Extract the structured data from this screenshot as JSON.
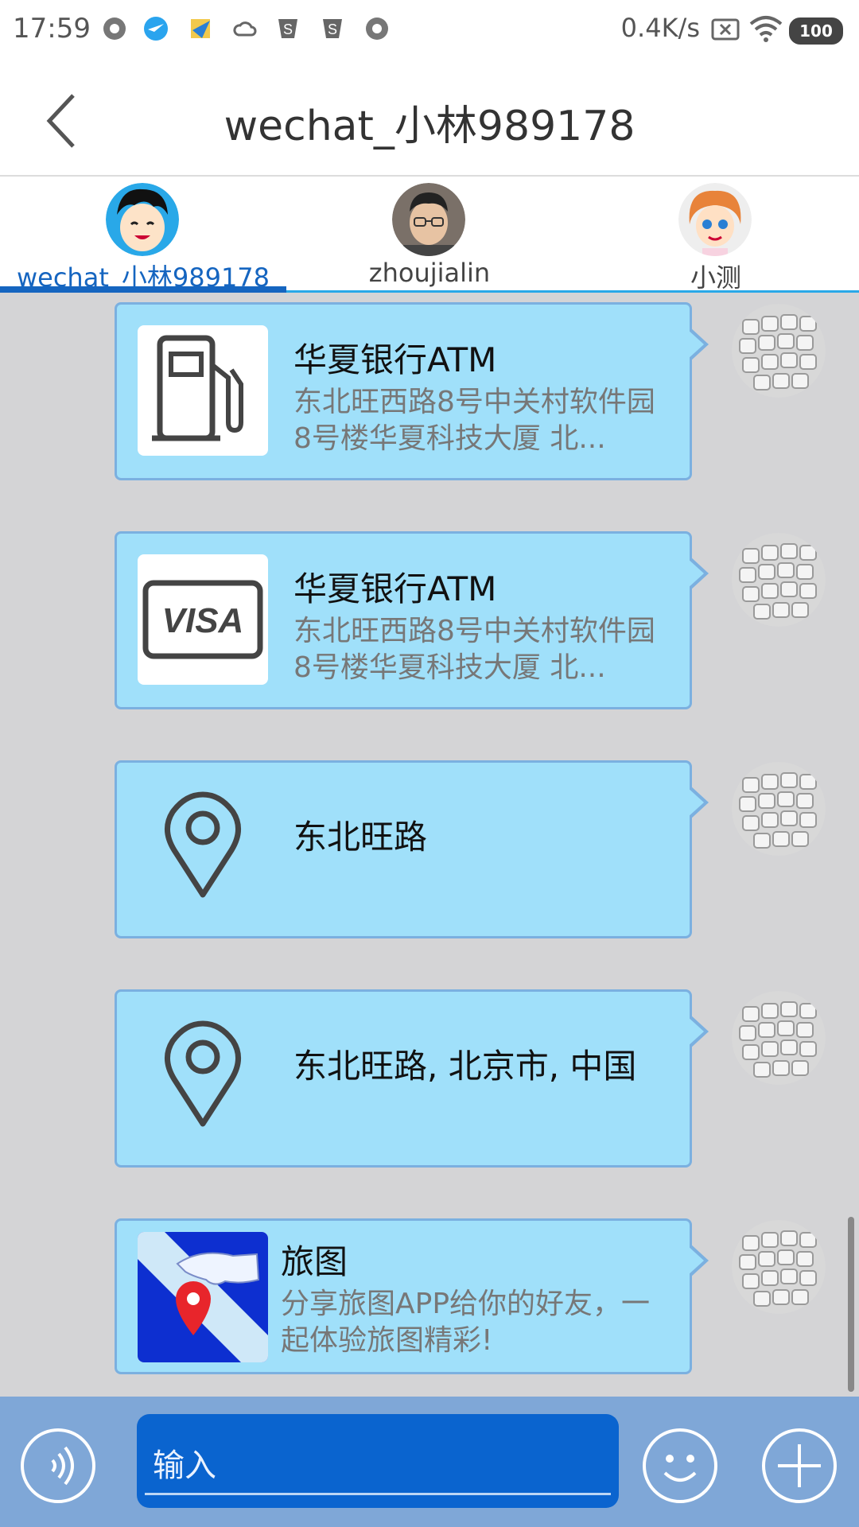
{
  "status_bar": {
    "time": "17:59",
    "network_speed": "0.4K/s",
    "battery": "100"
  },
  "header": {
    "title": "wechat_小林989178"
  },
  "tabs": [
    {
      "label": "wechat_小林989178",
      "active": true
    },
    {
      "label": "zhoujialin",
      "active": false
    },
    {
      "label": "小测",
      "active": false
    }
  ],
  "messages": [
    {
      "type": "poi",
      "icon": "gas-pump-icon",
      "title": "华夏银行ATM",
      "desc": "东北旺西路8号中关村软件园8号楼华夏科技大厦 北..."
    },
    {
      "type": "poi",
      "icon": "visa-card-icon",
      "title": "华夏银行ATM",
      "desc": "东北旺西路8号中关村软件园8号楼华夏科技大厦 北..."
    },
    {
      "type": "location",
      "icon": "location-pin-icon",
      "text": "东北旺路"
    },
    {
      "type": "location",
      "icon": "location-pin-icon",
      "text": "东北旺路, 北京市, 中国"
    },
    {
      "type": "share",
      "icon": "app-logo",
      "title": "旅图",
      "desc": "分享旅图APP给你的好友，一起体验旅图精彩!"
    }
  ],
  "input": {
    "placeholder": "输入"
  },
  "colors": {
    "bubble": "#a0e0fa",
    "bubble_border": "#7bb0e0",
    "input_bar": "#7fa7d7",
    "input_field": "#0a64cf",
    "tab_active": "#1565c0"
  }
}
